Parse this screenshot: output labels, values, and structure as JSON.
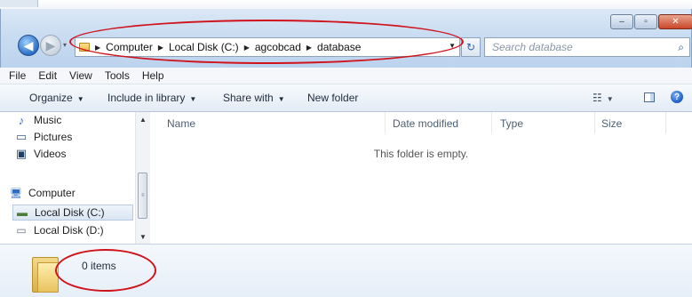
{
  "window": {
    "controls": {
      "minimize": "–",
      "maximize": "▫",
      "close": "✕"
    }
  },
  "navigation": {
    "back_glyph": "◀",
    "forward_glyph": "▶",
    "recent_glyph": "▾"
  },
  "address": {
    "crumbs": [
      "Computer",
      "Local Disk (C:)",
      "agcobcad",
      "database"
    ],
    "separator": "▶",
    "dropdown_glyph": "▼",
    "refresh_glyph": "↻"
  },
  "search": {
    "placeholder": "Search database",
    "icon": "search-icon",
    "glyph": "⌕"
  },
  "menu": [
    "File",
    "Edit",
    "View",
    "Tools",
    "Help"
  ],
  "toolbar": {
    "organize": "Organize",
    "include_in_library": "Include in library",
    "share_with": "Share with",
    "new_folder": "New folder",
    "dropdown_glyph": "▼",
    "views_glyph": "☷",
    "help_glyph": "?"
  },
  "nav_pane": {
    "items": [
      {
        "label": "Music",
        "icon": "music-icon",
        "glyph": "♪"
      },
      {
        "label": "Pictures",
        "icon": "pictures-icon",
        "glyph": "▭"
      },
      {
        "label": "Videos",
        "icon": "videos-icon",
        "glyph": "▣"
      },
      {
        "label": "Computer",
        "icon": "computer-icon",
        "glyph": "🖥"
      },
      {
        "label": "Local Disk (C:)",
        "icon": "drive-icon",
        "glyph": "▬",
        "selected": true
      },
      {
        "label": "Local Disk (D:)",
        "icon": "drive-icon",
        "glyph": "▭"
      }
    ]
  },
  "columns": [
    "Name",
    "Date modified",
    "Type",
    "Size"
  ],
  "content": {
    "empty_message": "This folder is empty."
  },
  "details": {
    "item_count": "0 items"
  },
  "colors": {
    "annotation_red": "#d0121b",
    "titlebar_blue": "#c9dcf1"
  }
}
